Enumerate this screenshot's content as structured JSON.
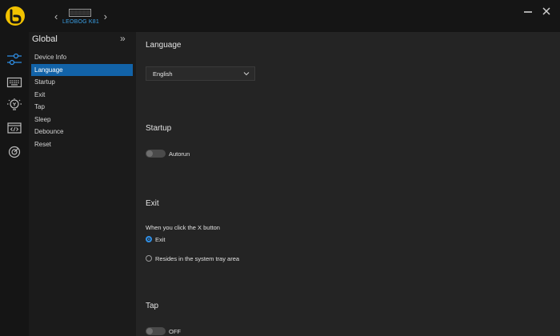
{
  "header": {
    "device_name": "LEOBOG K81",
    "prev_label": "‹",
    "next_label": "›",
    "minimize_label": "—",
    "close_label": "✕"
  },
  "colors": {
    "accent": "#1263a8",
    "logo_yellow": "#f2c200",
    "device_name": "#3aa0e6",
    "radio_active": "#2f8fe6"
  },
  "iconbar": {
    "items": [
      {
        "icon": "sliders-icon",
        "active": true
      },
      {
        "icon": "keyboard-icon"
      },
      {
        "icon": "lightbulb-icon"
      },
      {
        "icon": "code-window-icon"
      },
      {
        "icon": "target-icon"
      }
    ]
  },
  "submenu": {
    "title": "Global",
    "collapse_label": "»",
    "items": [
      {
        "label": "Device Info"
      },
      {
        "label": "Language",
        "active": true
      },
      {
        "label": "Startup"
      },
      {
        "label": "Exit"
      },
      {
        "label": "Tap"
      },
      {
        "label": "Sleep"
      },
      {
        "label": "Debounce"
      },
      {
        "label": "Reset"
      }
    ]
  },
  "language": {
    "title": "Language",
    "selected": "English"
  },
  "startup": {
    "title": "Startup",
    "toggle_label": "Autorun",
    "enabled": false
  },
  "exit": {
    "title": "Exit",
    "prompt": "When you click the X button",
    "options": [
      {
        "label": "Exit",
        "checked": true
      },
      {
        "label": "Resides in the system tray area",
        "checked": false
      }
    ]
  },
  "tap": {
    "title": "Tap",
    "toggle_label": "OFF",
    "enabled": false
  }
}
